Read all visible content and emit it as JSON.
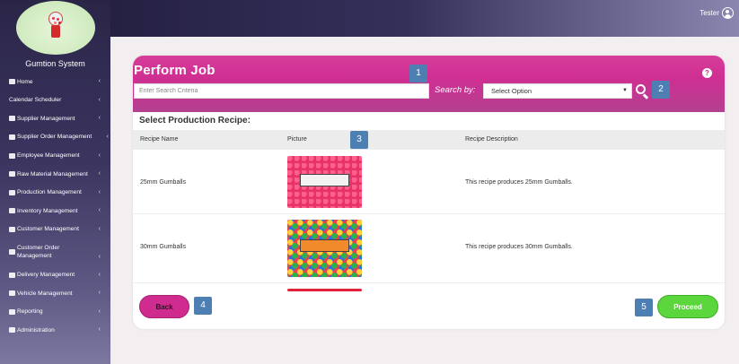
{
  "app": {
    "name": "Gumtion System"
  },
  "header": {
    "user": "Tester"
  },
  "sidebar": {
    "items": [
      {
        "label": "Home"
      },
      {
        "label": "Calendar Scheduler"
      },
      {
        "label": "Supplier Management"
      },
      {
        "label": "Supplier Order Management"
      },
      {
        "label": "Employee Management"
      },
      {
        "label": "Raw Material Management"
      },
      {
        "label": "Production Management"
      },
      {
        "label": "Inventory Management"
      },
      {
        "label": "Customer Management"
      },
      {
        "label": "Customer Order Management"
      },
      {
        "label": "Delivery Management"
      },
      {
        "label": "Vehicle Management"
      },
      {
        "label": "Reporting"
      },
      {
        "label": "Administration"
      }
    ]
  },
  "page": {
    "title": "Perform Job",
    "help": "?",
    "search": {
      "placeholder": "Enter Search Criteria",
      "value": ""
    },
    "search_by_label": "Search by:",
    "select": {
      "selected": "Select Option"
    },
    "section_title": "Select Production Recipe:",
    "table": {
      "headers": [
        "Recipe Name",
        "Picture",
        "Recipe Description"
      ],
      "rows": [
        {
          "name": "25mm Gumballs",
          "description": "This recipe produces 25mm Gumballs."
        },
        {
          "name": "30mm Gumballs",
          "description": "This recipe produces 30mm Gumballs."
        }
      ]
    },
    "back_label": "Back",
    "proceed_label": "Proceed"
  },
  "callouts": [
    "1",
    "2",
    "3",
    "4",
    "5"
  ],
  "colors": {
    "accent_pink": "#d02b8f",
    "proceed_green": "#5bd63c",
    "callout_blue": "#4e7fb2",
    "sidebar_dark": "#2a2547"
  }
}
